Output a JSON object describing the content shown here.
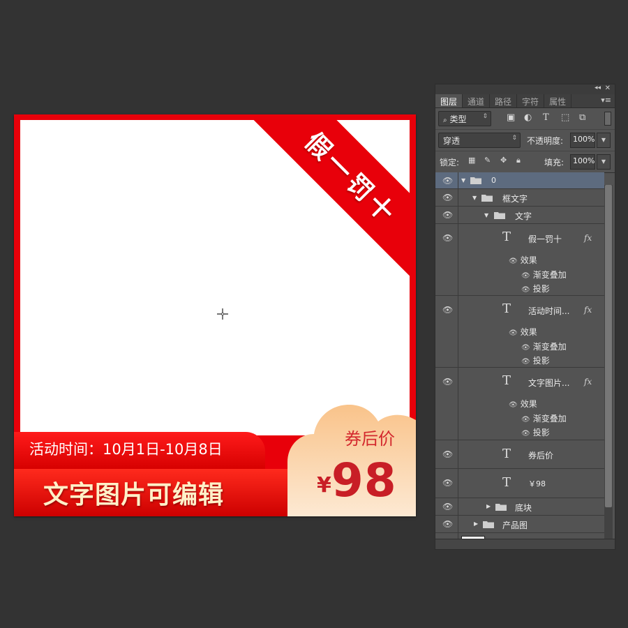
{
  "canvas": {
    "corner_ribbon_text": "假一罚十",
    "date_text": "活动时间：10月1日-10月8日",
    "bottom_text": "文字图片可编辑",
    "coupon_label": "券后价",
    "price_symbol": "¥",
    "price_value": "98",
    "colors": {
      "red": "#e8000a",
      "price_red": "#c81e26",
      "badge_peach": "#f9c98e"
    }
  },
  "panel": {
    "tabs": [
      "图层",
      "通道",
      "路径",
      "字符",
      "属性"
    ],
    "active_tab": "图层",
    "filter": {
      "label": "类型",
      "icons": [
        "image-icon",
        "adjustment-icon",
        "type-icon",
        "shape-icon",
        "smart-object-icon"
      ]
    },
    "blend_mode": "穿透",
    "opacity_label": "不透明度:",
    "opacity_value": "100%",
    "lock_label": "锁定:",
    "fill_label": "填充:",
    "fill_value": "100%",
    "layers": {
      "group_0": "0",
      "group_frame_text": "框文字",
      "group_text": "文字",
      "text_layer_1": {
        "name": "假一罚十",
        "fx": "fx",
        "effects_label": "效果",
        "effect_1": "渐变叠加",
        "effect_2": "投影"
      },
      "text_layer_2": {
        "name": "活动时间...",
        "fx": "fx",
        "effects_label": "效果",
        "effect_1": "渐变叠加",
        "effect_2": "投影"
      },
      "text_layer_3": {
        "name": "文字图片...",
        "fx": "fx",
        "effects_label": "效果",
        "effect_1": "渐变叠加",
        "effect_2": "投影"
      },
      "text_layer_4": {
        "name": "券后价"
      },
      "text_layer_5": {
        "name": "￥98"
      },
      "group_base": "底块",
      "group_product": "产品图"
    },
    "type_glyph": "T"
  }
}
